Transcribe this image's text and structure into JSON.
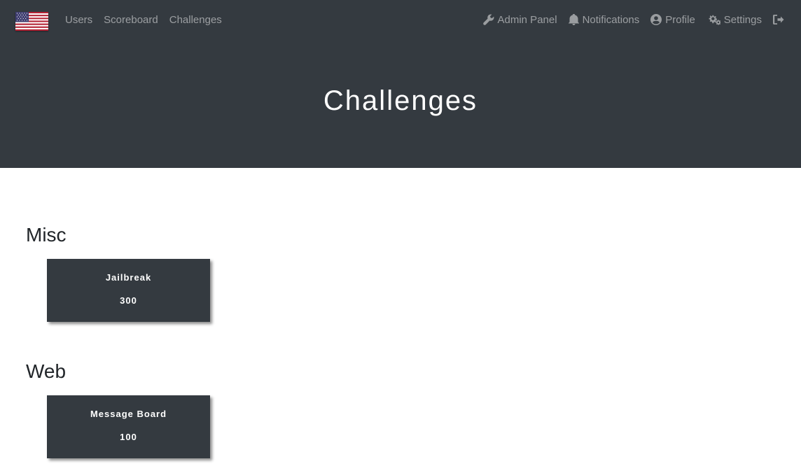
{
  "navbar": {
    "brand_icon": "us-flag-icon",
    "left_links": [
      {
        "label": "Users"
      },
      {
        "label": "Scoreboard"
      },
      {
        "label": "Challenges"
      }
    ],
    "right_links": [
      {
        "label": "Admin Panel",
        "icon": "wrench-icon"
      },
      {
        "label": "Notifications",
        "icon": "bell-icon"
      },
      {
        "label": "Profile",
        "icon": "user-circle-icon"
      },
      {
        "label": "Settings",
        "icon": "cogs-icon"
      },
      {
        "label": "",
        "icon": "sign-out-icon"
      }
    ]
  },
  "page": {
    "title": "Challenges"
  },
  "categories": [
    {
      "name": "Misc",
      "challenges": [
        {
          "name": "Jailbreak",
          "value": "300"
        }
      ]
    },
    {
      "name": "Web",
      "challenges": [
        {
          "name": "Message Board",
          "value": "100"
        }
      ]
    }
  ],
  "colors": {
    "navbar_bg": "#343a40",
    "card_bg": "#343a40",
    "link": "rgba(255,255,255,0.5)",
    "heading": "#212529"
  }
}
